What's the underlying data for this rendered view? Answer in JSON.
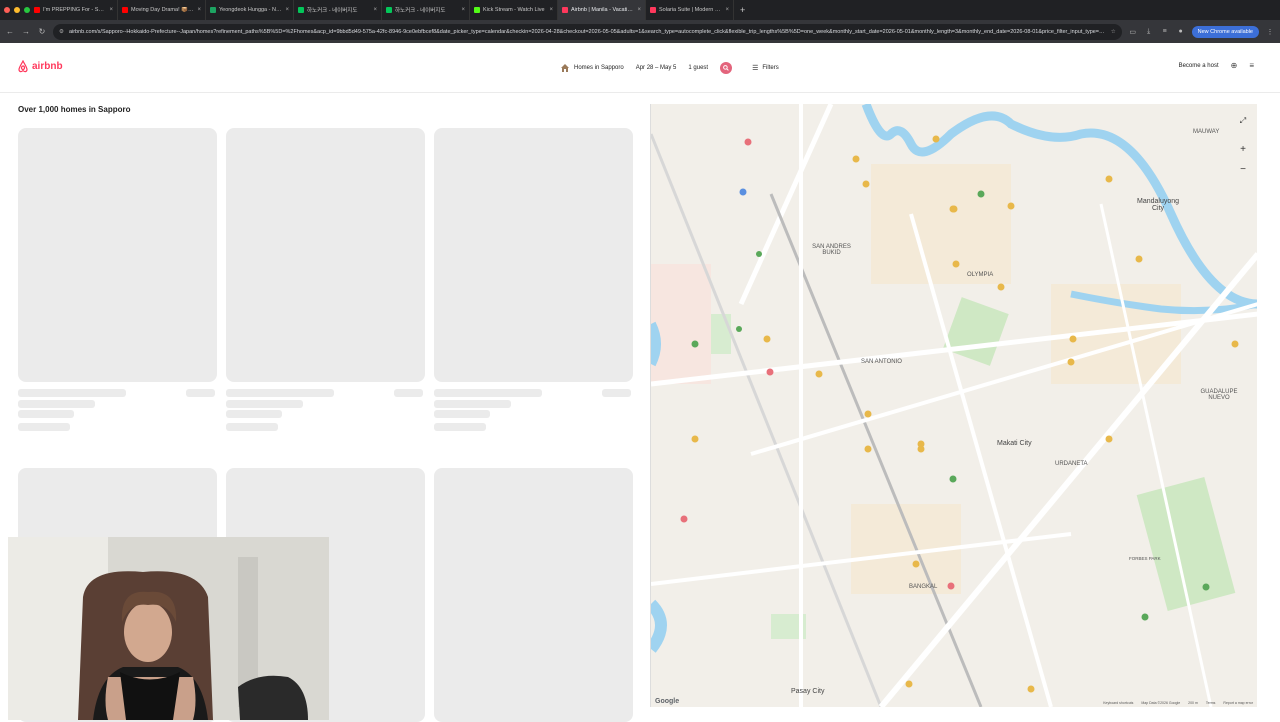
{
  "browser": {
    "tabs": [
      {
        "label": "I'm PREPPING For - Societal",
        "color": "#ff0000"
      },
      {
        "label": "Moving Day Drama! 📦 + Exp",
        "color": "#ff0000"
      },
      {
        "label": "Yeongdeok Hungga - Namu",
        "color": "#1da462"
      },
      {
        "label": "하노커크 - 네이버지도",
        "color": "#03c75a"
      },
      {
        "label": "하노커크 - 네이버지도",
        "color": "#03c75a"
      },
      {
        "label": "Kick Stream - Watch Live",
        "color": "#53fc18"
      },
      {
        "label": "Airbnb | Manila - Vacation R",
        "color": "#ff385c",
        "active": true
      },
      {
        "label": "Solaria Suite | Modern Condo",
        "color": "#ff385c"
      }
    ],
    "url": "airbnb.com/s/Sapporo--Hokkaido-Prefecture--Japan/homes?refinement_paths%5B%5D=%2Fhomes&acp_id=9bbd5d49-575a-42fc-8946-9ce0ebfbcef8&date_picker_type=calendar&checkin=2026-04-28&checkout=2026-05-05&adults=1&search_type=autocomplete_click&flexible_trip_lengths%5B%5D=one_week&monthly_start_date=2026-05-01&monthly_length=3&monthly_end_date=2026-08-01&price_filter_input_type=2&price...",
    "update_pill": "New Chrome available"
  },
  "header": {
    "logo": "airbnb",
    "location": "Homes in Sapporo",
    "dates": "Apr 28 – May 5",
    "guests": "1 guest",
    "filters": "Filters",
    "become_host": "Become a host"
  },
  "results": {
    "title": "Over 1,000 homes in Sapporo"
  },
  "map": {
    "labels": {
      "mauway": "MAUWAY",
      "mandaluyong": "Mandaluyong City",
      "san_andres": "SAN ANDRES BUKID",
      "olympia": "OLYMPIA",
      "san_antonio": "SAN ANTONIO",
      "makati": "Makati City",
      "urdaneta": "URDANETA",
      "guadalupe": "GUADALUPE NUEVO",
      "bangkal": "BANGKAL",
      "pasay": "Pasay City",
      "forbes": "FORBES PARK"
    },
    "footer": {
      "shortcuts": "Keyboard shortcuts",
      "mapdata": "Map Data ©2026 Google",
      "scale": "200 m",
      "terms": "Terms",
      "report": "Report a map error"
    },
    "google": "Google"
  },
  "colors": {
    "brand": "#ff385c",
    "skeleton": "#ebebeb"
  }
}
